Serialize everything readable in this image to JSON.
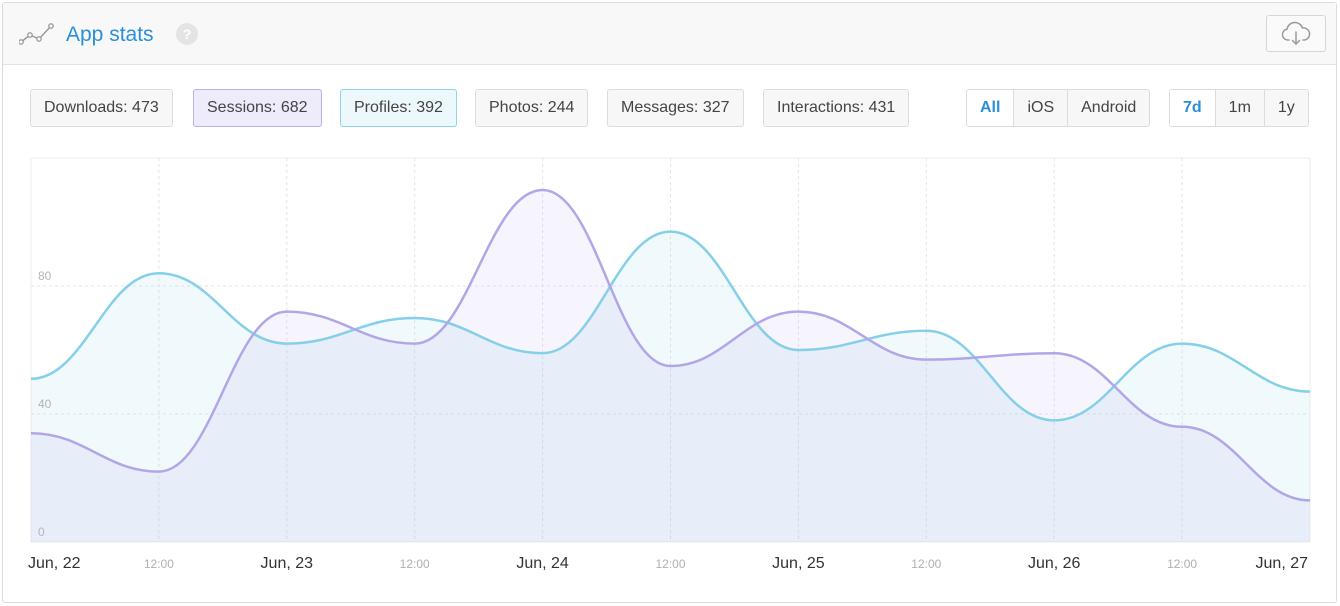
{
  "header": {
    "title": "App stats",
    "help_icon": "question-circle-icon",
    "chart_icon": "line-chart-icon",
    "download_icon": "cloud-download-icon",
    "help_glyph": "?"
  },
  "metrics": [
    {
      "label": "Downloads: 473",
      "state": "normal"
    },
    {
      "label": "Sessions: 682",
      "state": "sessions"
    },
    {
      "label": "Profiles: 392",
      "state": "profiles"
    },
    {
      "label": "Photos: 244",
      "state": "normal"
    },
    {
      "label": "Messages: 327",
      "state": "normal"
    },
    {
      "label": "Interactions: 431",
      "state": "normal"
    }
  ],
  "platform_filter": {
    "options": [
      "All",
      "iOS",
      "Android"
    ],
    "selected": "All"
  },
  "range_filter": {
    "options": [
      "7d",
      "1m",
      "1y"
    ],
    "selected": "7d"
  },
  "colors": {
    "accent": "#2a8fd9",
    "profiles_line": "#85d0e8",
    "sessions_line": "#b3a6e8"
  },
  "chart_data": {
    "type": "area",
    "x_tick_labels": [
      "Jun, 22",
      "12:00",
      "Jun, 23",
      "12:00",
      "Jun, 24",
      "12:00",
      "Jun, 25",
      "12:00",
      "Jun, 26",
      "12:00",
      "Jun, 27"
    ],
    "y_ticks": [
      0,
      40,
      80
    ],
    "ylim": [
      0,
      120
    ],
    "grid": true,
    "series": [
      {
        "name": "Profiles: 392",
        "color": "#85d0e8",
        "values": [
          51,
          84,
          62,
          70,
          59,
          97,
          60,
          66,
          38,
          62,
          47
        ]
      },
      {
        "name": "Sessions: 682",
        "color": "#b3a6e8",
        "values": [
          34,
          22,
          72,
          62,
          110,
          55,
          72,
          57,
          59,
          36,
          13
        ]
      }
    ]
  }
}
